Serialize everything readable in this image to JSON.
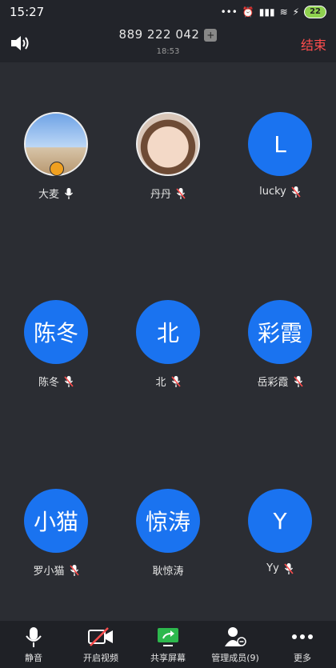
{
  "status": {
    "time": "15:27",
    "battery": "22"
  },
  "header": {
    "meeting_id": "889 222 042",
    "elapsed": "18:53",
    "end_label": "结束"
  },
  "participants": [
    {
      "name": "大麦",
      "avatar_text": "",
      "muted": false,
      "host": true
    },
    {
      "name": "丹丹",
      "avatar_text": "",
      "muted": true,
      "host": false
    },
    {
      "name": "lucky",
      "avatar_text": "L",
      "muted": true,
      "host": false
    },
    {
      "name": "陈冬",
      "avatar_text": "陈冬",
      "muted": true,
      "host": false
    },
    {
      "name": "北",
      "avatar_text": "北",
      "muted": true,
      "host": false
    },
    {
      "name": "岳彩霞",
      "avatar_text": "彩霞",
      "muted": true,
      "host": false
    },
    {
      "name": "罗小猫",
      "avatar_text": "小猫",
      "muted": true,
      "host": false
    },
    {
      "name": "耿惊涛",
      "avatar_text": "惊涛",
      "muted": false,
      "host": false
    },
    {
      "name": "Yy",
      "avatar_text": "Y",
      "muted": true,
      "host": false
    }
  ],
  "toolbar": {
    "mute_label": "静音",
    "video_label": "开启视频",
    "share_label": "共享屏幕",
    "members_label": "管理成员(9)",
    "more_label": "更多"
  },
  "colors": {
    "avatar_blue": "#1a73f0",
    "end_red": "#ff4d4d",
    "share_green": "#2db84d"
  }
}
